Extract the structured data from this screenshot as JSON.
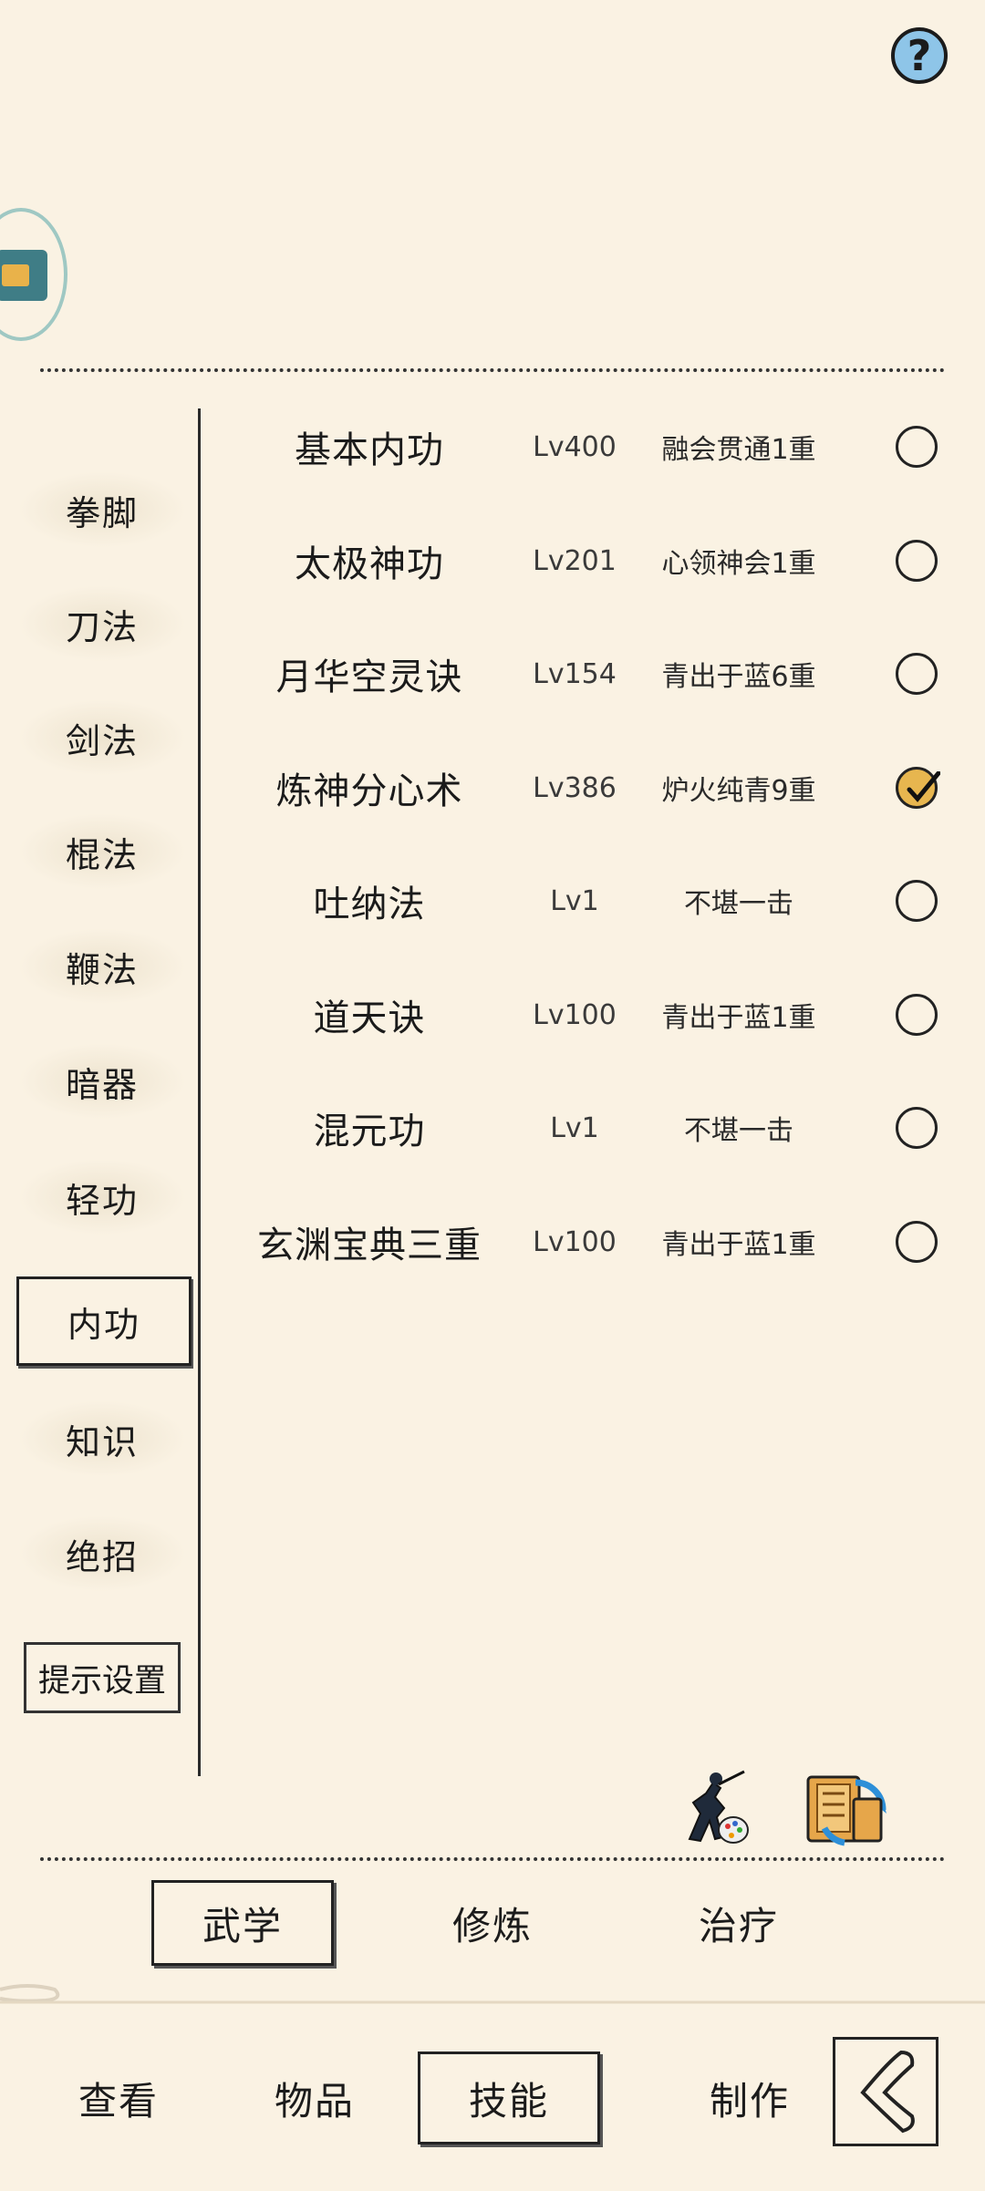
{
  "header": {
    "help_icon": "question-circle-icon",
    "help_label": "?",
    "avatar_icon": "game-avatar-icon"
  },
  "categories": [
    {
      "label": "拳脚",
      "active": false
    },
    {
      "label": "刀法",
      "active": false
    },
    {
      "label": "剑法",
      "active": false
    },
    {
      "label": "棍法",
      "active": false
    },
    {
      "label": "鞭法",
      "active": false
    },
    {
      "label": "暗器",
      "active": false
    },
    {
      "label": "轻功",
      "active": false
    },
    {
      "label": "内功",
      "active": true
    },
    {
      "label": "知识",
      "active": false
    },
    {
      "label": "绝招",
      "active": false
    }
  ],
  "hint_settings_label": "提示设置",
  "skills": [
    {
      "name": "基本内功",
      "level": "Lv400",
      "rank": "融会贯通1重",
      "equipped": false
    },
    {
      "name": "太极神功",
      "level": "Lv201",
      "rank": "心领神会1重",
      "equipped": false
    },
    {
      "name": "月华空灵诀",
      "level": "Lv154",
      "rank": "青出于蓝6重",
      "equipped": false
    },
    {
      "name": "炼神分心术",
      "level": "Lv386",
      "rank": "炉火纯青9重",
      "equipped": true
    },
    {
      "name": "吐纳法",
      "level": "Lv1",
      "rank": "不堪一击",
      "equipped": false
    },
    {
      "name": "道天诀",
      "level": "Lv100",
      "rank": "青出于蓝1重",
      "equipped": false
    },
    {
      "name": "混元功",
      "level": "Lv1",
      "rank": "不堪一击",
      "equipped": false
    },
    {
      "name": "玄渊宝典三重",
      "level": "Lv100",
      "rank": "青出于蓝1重",
      "equipped": false
    }
  ],
  "action_icons": [
    "martial-artist-palette-icon",
    "scroll-swap-icon"
  ],
  "subtabs": [
    {
      "label": "武学",
      "active": true
    },
    {
      "label": "修炼",
      "active": false
    },
    {
      "label": "治疗",
      "active": false
    }
  ],
  "bottom_nav": [
    {
      "label": "查看",
      "active": false
    },
    {
      "label": "物品",
      "active": false
    },
    {
      "label": "技能",
      "active": true
    },
    {
      "label": "制作",
      "active": false
    }
  ],
  "back_icon": "back-arrow-icon",
  "colors": {
    "background": "#faf2e3",
    "checked": "#e7b64f",
    "help": "#8ec5e8"
  }
}
